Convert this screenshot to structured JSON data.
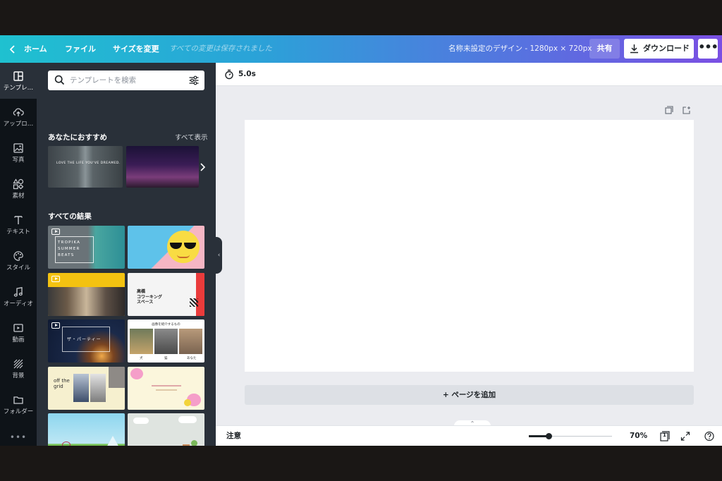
{
  "topbar": {
    "home": "ホーム",
    "file": "ファイル",
    "resize": "サイズを変更",
    "saved_status": "すべての変更は保存されました",
    "design_title": "名称未設定のデザイン - 1280px × 720px",
    "share": "共有",
    "download": "ダウンロード",
    "more": "•••"
  },
  "rail": [
    {
      "label": "テンプレ…",
      "icon": "template-icon"
    },
    {
      "label": "アップロ…",
      "icon": "upload-cloud-icon"
    },
    {
      "label": "写真",
      "icon": "photo-icon"
    },
    {
      "label": "素材",
      "icon": "elements-icon"
    },
    {
      "label": "テキスト",
      "icon": "text-icon"
    },
    {
      "label": "スタイル",
      "icon": "palette-icon"
    },
    {
      "label": "オーディオ",
      "icon": "music-note-icon"
    },
    {
      "label": "動画",
      "icon": "video-icon"
    },
    {
      "label": "背景",
      "icon": "background-pattern-icon"
    },
    {
      "label": "フォルダー",
      "icon": "folder-icon"
    }
  ],
  "rail_more": "•••",
  "panel": {
    "search_placeholder": "テンプレートを検索",
    "recommended_title": "あなたにおすすめ",
    "see_all": "すべて表示",
    "rec1_text": "LOVE THE LIFE YOU'VE DREAMED.",
    "all_results_title": "すべての結果",
    "thumbs": {
      "t1": "TROPIKA SUMMER BEATS",
      "t3": "",
      "t4": "高橋\nコワーキング\nスペース",
      "t5": "ザ・パーティー",
      "t6_title": "画像を紹介するもの",
      "t6_labels": [
        "犬",
        "猫",
        "あなた"
      ],
      "t7": "off the grid"
    }
  },
  "editor": {
    "duration": "5.0s",
    "add_page": "+ ページを追加",
    "notes": "注意",
    "zoom": "70%",
    "zoom_percent": 70,
    "page_count": "1"
  },
  "colors": {
    "gradient_start": "#1fc1d0",
    "gradient_end": "#7a4fe3",
    "panel_bg": "#293039",
    "rail_bg": "#0e1318"
  }
}
